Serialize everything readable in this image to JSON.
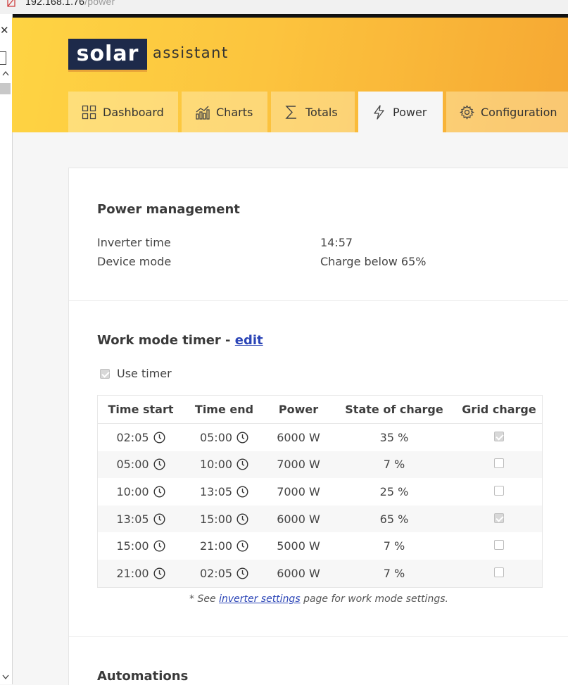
{
  "browser": {
    "url_host": "192.168.1.76",
    "url_path": "/power",
    "close_glyph": "✕"
  },
  "logo": {
    "solar": "solar",
    "assistant": "assistant"
  },
  "tabs": [
    {
      "label": "Dashboard",
      "icon": "dashboard-grid-icon"
    },
    {
      "label": "Charts",
      "icon": "chart-icon"
    },
    {
      "label": "Totals",
      "icon": "sigma-icon"
    },
    {
      "label": "Power",
      "icon": "bolt-icon",
      "active": true
    },
    {
      "label": "Configuration",
      "icon": "gear-icon"
    }
  ],
  "power_management": {
    "title": "Power management",
    "inverter_time_label": "Inverter time",
    "inverter_time_value": "14:57",
    "device_mode_label": "Device mode",
    "device_mode_value": "Charge below 65%"
  },
  "work_mode": {
    "title_prefix": "Work mode timer - ",
    "edit_label": "edit",
    "use_timer_label": "Use timer",
    "use_timer_checked": true,
    "columns": [
      "Time start",
      "Time end",
      "Power",
      "State of charge",
      "Grid charge"
    ],
    "rows": [
      {
        "start": "02:05",
        "end": "05:00",
        "power": "6000 W",
        "soc": "35 %",
        "grid": true
      },
      {
        "start": "05:00",
        "end": "10:00",
        "power": "7000 W",
        "soc": "7 %",
        "grid": false
      },
      {
        "start": "10:00",
        "end": "13:05",
        "power": "7000 W",
        "soc": "25 %",
        "grid": false
      },
      {
        "start": "13:05",
        "end": "15:00",
        "power": "6000 W",
        "soc": "65 %",
        "grid": true
      },
      {
        "start": "15:00",
        "end": "21:00",
        "power": "5000 W",
        "soc": "7 %",
        "grid": false
      },
      {
        "start": "21:00",
        "end": "02:05",
        "power": "6000 W",
        "soc": "7 %",
        "grid": false
      }
    ],
    "note_prefix": "* See ",
    "note_link": "inverter settings",
    "note_suffix": " page for work mode settings."
  },
  "automations": {
    "title": "Automations"
  },
  "colors": {
    "header_start": "#fed443",
    "header_end": "#f6a833",
    "logo_bg": "#1d2a4a",
    "link": "#2a44b6"
  }
}
